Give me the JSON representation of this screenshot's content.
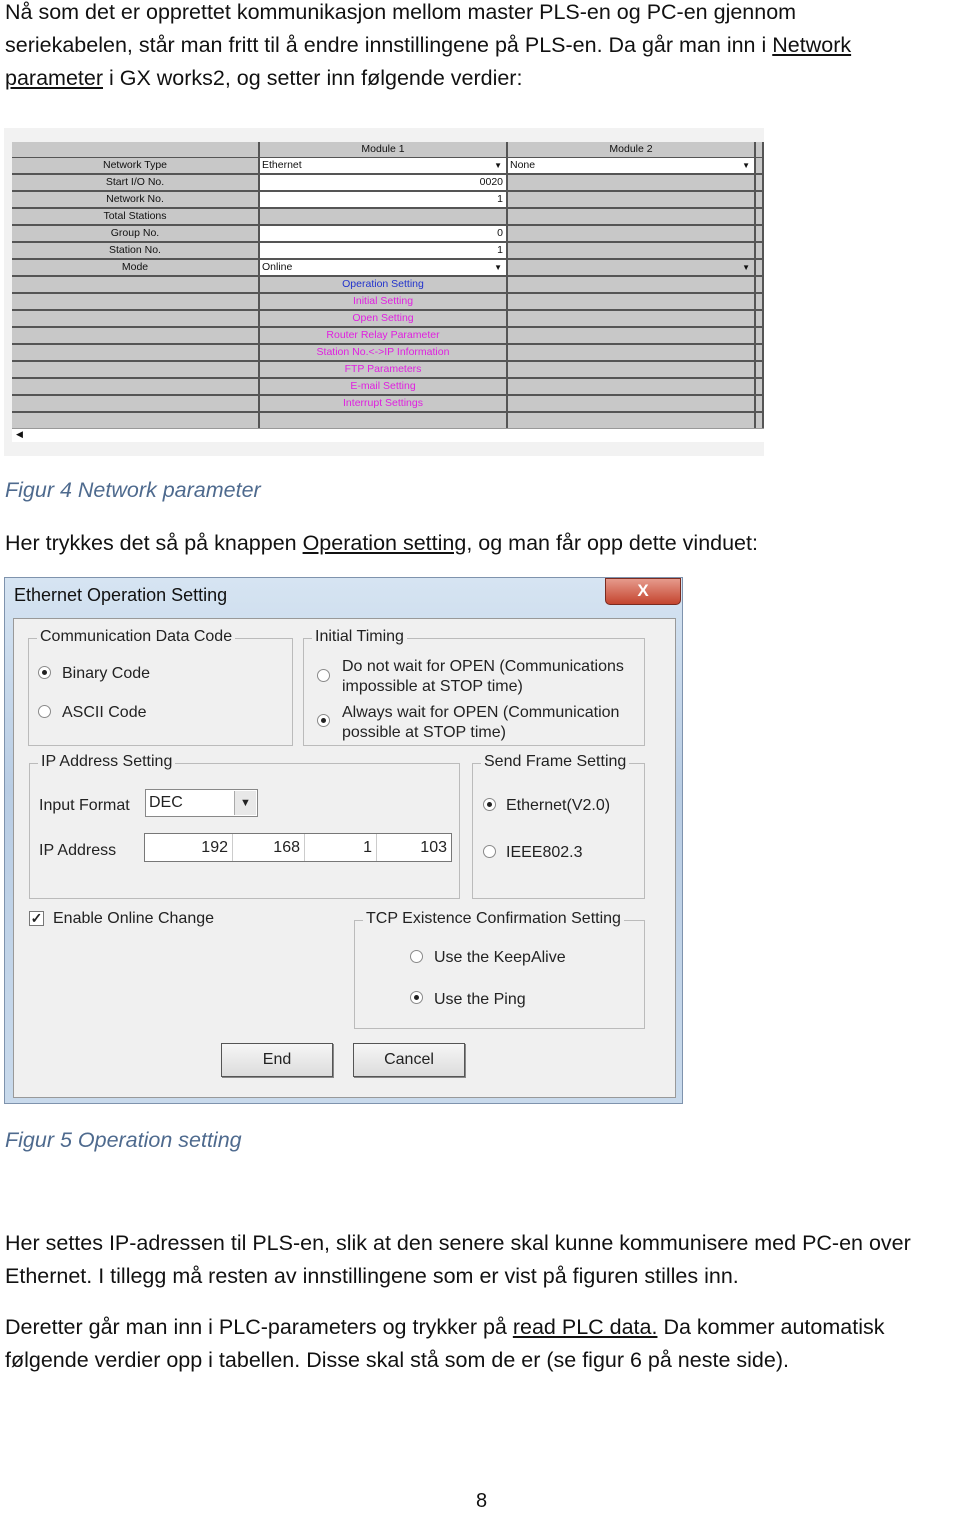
{
  "paragraphs": {
    "p1": {
      "l1": "Nå som det er opprettet kommunikasjon mellom master PLS-en og PC-en gjennom",
      "l2": "seriekabelen, står man fritt til å endre innstillingene på PLS-en. Da går man inn i ",
      "l2_link": "Network",
      "l3_link": "parameter",
      "l3": " i GX works2, og setter inn følgende verdier:"
    },
    "p2": {
      "a": "Her trykkes det så på knappen ",
      "link": "Operation setting",
      "b": ", og man får opp dette vinduet:"
    },
    "p3": {
      "l1": "Her settes IP-adressen til PLS-en, slik at den senere skal kunne kommunisere med PC-en over",
      "l2": "Ethernet. I tillegg må resten av innstillingene som er vist på figuren stilles inn."
    },
    "p4": {
      "a": "Deretter går man inn i PLC-parameters og trykker på ",
      "link": "read PLC data.",
      "b": " Da kommer automatisk",
      "l2": "følgende verdier opp i tabellen. Disse skal stå som de er (se figur 6 på neste side)."
    }
  },
  "captions": {
    "fig4": "Figur 4 Network parameter",
    "fig5": "Figur 5 Operation setting"
  },
  "page_number": "8",
  "network_table": {
    "headers": [
      "Module 1",
      "Module 2"
    ],
    "rows": [
      {
        "label": "Network Type",
        "m1": "Ethernet",
        "m2": "None"
      },
      {
        "label": "Start I/O No.",
        "m1": "0020"
      },
      {
        "label": "Network No.",
        "m1": "1"
      },
      {
        "label": "Total Stations",
        "m1": ""
      },
      {
        "label": "Group No.",
        "m1": "0"
      },
      {
        "label": "Station No.",
        "m1": "1"
      },
      {
        "label": "Mode",
        "m1": "Online"
      }
    ],
    "links": [
      "Operation Setting",
      "Initial Setting",
      "Open Setting",
      "Router Relay Parameter",
      "Station No.<->IP Information",
      "FTP Parameters",
      "E-mail Setting",
      "Interrupt Settings"
    ],
    "colors": {
      "active_link": "#2233cc",
      "link": "#e020e0"
    }
  },
  "dialog": {
    "title": "Ethernet Operation Setting",
    "close": "X",
    "comm_code": {
      "label": "Communication Data Code",
      "binary": "Binary Code",
      "ascii": "ASCII Code",
      "selected": "Binary Code"
    },
    "initial_timing": {
      "label": "Initial Timing",
      "opt1a": "Do not wait for OPEN (Communications",
      "opt1b": "impossible at STOP time)",
      "opt2a": "Always wait for OPEN (Communication",
      "opt2b": "possible at STOP time)",
      "selected": "Always wait"
    },
    "ip_setting": {
      "label": "IP Address Setting",
      "input_format_label": "Input Format",
      "input_format": "DEC",
      "ip_label": "IP Address",
      "ip": [
        "192",
        "168",
        "1",
        "103"
      ]
    },
    "send_frame": {
      "label": "Send Frame Setting",
      "eth": "Ethernet(V2.0)",
      "ieee": "IEEE802.3",
      "selected": "Ethernet(V2.0)"
    },
    "online_change": {
      "label": "Enable Online Change",
      "checked": true
    },
    "tcp": {
      "label": "TCP Existence Confirmation Setting",
      "keepalive": "Use the KeepAlive",
      "ping": "Use the Ping",
      "selected": "Use the Ping"
    },
    "end": "End",
    "cancel": "Cancel"
  }
}
